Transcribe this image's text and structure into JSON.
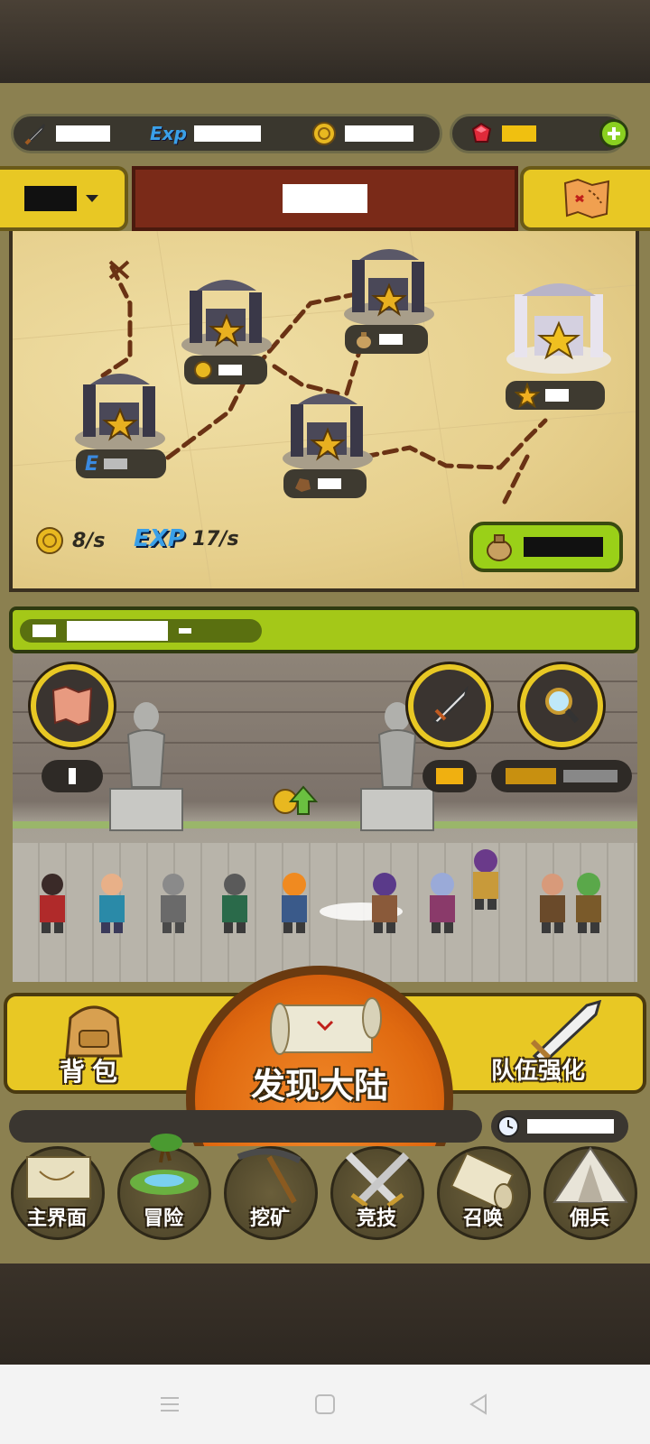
{
  "resources": {
    "attack_label": "",
    "exp_icon_text": "Exp",
    "gold_label": "",
    "gems_label": ""
  },
  "region": {
    "title": ""
  },
  "map": {
    "gold_rate": "8/s",
    "exp_rate_label": "EXP",
    "exp_rate": "17/s",
    "node_e_letter": "E"
  },
  "action_bar": {
    "backpack_label": "背包",
    "discover_label": "发现大陆",
    "team_upgrade_label": "队伍强化"
  },
  "nav": {
    "items": [
      {
        "label": "主界面"
      },
      {
        "label": "冒险"
      },
      {
        "label": "挖矿"
      },
      {
        "label": "竞技"
      },
      {
        "label": "召唤"
      },
      {
        "label": "佣兵"
      }
    ]
  },
  "colors": {
    "accent_yellow": "#e8c824",
    "header_red": "#7a2a18",
    "lime": "#a4c818",
    "orange": "#e06a10"
  }
}
